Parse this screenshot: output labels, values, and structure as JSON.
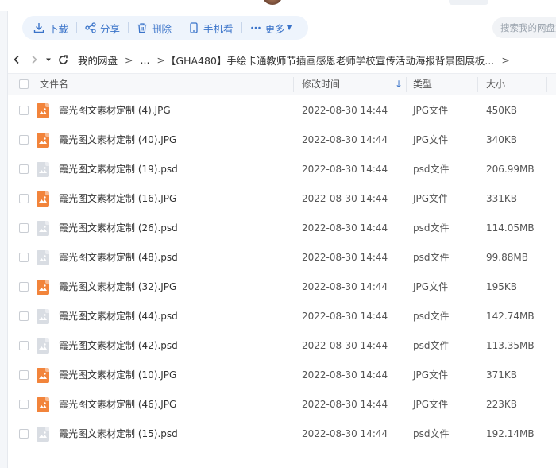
{
  "toolbar": {
    "download": "下载",
    "share": "分享",
    "delete": "删除",
    "phone_view": "手机看",
    "more": "更多"
  },
  "search": {
    "placeholder": "搜索我的网盘文"
  },
  "breadcrumb": {
    "root": "我的网盘",
    "ellipsis": "...",
    "folder": "【GHA480】手绘卡通教师节插画感恩老师学校宣传活动海报背景图展板..."
  },
  "columns": {
    "name": "文件名",
    "modified": "修改时间",
    "type": "类型",
    "size": "大小"
  },
  "files": [
    {
      "name": "霞光图文素材定制 (4).JPG",
      "modified": "2022-08-30 14:44",
      "type": "JPG文件",
      "size": "450KB",
      "kind": "jpg"
    },
    {
      "name": "霞光图文素材定制 (40).JPG",
      "modified": "2022-08-30 14:44",
      "type": "JPG文件",
      "size": "340KB",
      "kind": "jpg"
    },
    {
      "name": "霞光图文素材定制 (19).psd",
      "modified": "2022-08-30 14:44",
      "type": "psd文件",
      "size": "206.99MB",
      "kind": "psd"
    },
    {
      "name": "霞光图文素材定制 (16).JPG",
      "modified": "2022-08-30 14:44",
      "type": "JPG文件",
      "size": "331KB",
      "kind": "jpg"
    },
    {
      "name": "霞光图文素材定制 (26).psd",
      "modified": "2022-08-30 14:44",
      "type": "psd文件",
      "size": "114.05MB",
      "kind": "psd"
    },
    {
      "name": "霞光图文素材定制 (48).psd",
      "modified": "2022-08-30 14:44",
      "type": "psd文件",
      "size": "99.88MB",
      "kind": "psd"
    },
    {
      "name": "霞光图文素材定制 (32).JPG",
      "modified": "2022-08-30 14:44",
      "type": "JPG文件",
      "size": "195KB",
      "kind": "jpg"
    },
    {
      "name": "霞光图文素材定制 (44).psd",
      "modified": "2022-08-30 14:44",
      "type": "psd文件",
      "size": "142.74MB",
      "kind": "psd"
    },
    {
      "name": "霞光图文素材定制 (42).psd",
      "modified": "2022-08-30 14:44",
      "type": "psd文件",
      "size": "113.35MB",
      "kind": "psd"
    },
    {
      "name": "霞光图文素材定制 (10).JPG",
      "modified": "2022-08-30 14:44",
      "type": "JPG文件",
      "size": "371KB",
      "kind": "jpg"
    },
    {
      "name": "霞光图文素材定制 (46).JPG",
      "modified": "2022-08-30 14:44",
      "type": "JPG文件",
      "size": "223KB",
      "kind": "jpg"
    },
    {
      "name": "霞光图文素材定制 (15).psd",
      "modified": "2022-08-30 14:44",
      "type": "psd文件",
      "size": "192.14MB",
      "kind": "psd"
    }
  ],
  "colors": {
    "accent": "#3a73c9",
    "jpg_icon": "#f2843b",
    "psd_icon": "#d9dde3"
  },
  "icons": {
    "download": "download-icon",
    "share": "share-icon",
    "delete": "trash-icon",
    "phone": "phone-icon",
    "more": "more-dots-icon"
  }
}
